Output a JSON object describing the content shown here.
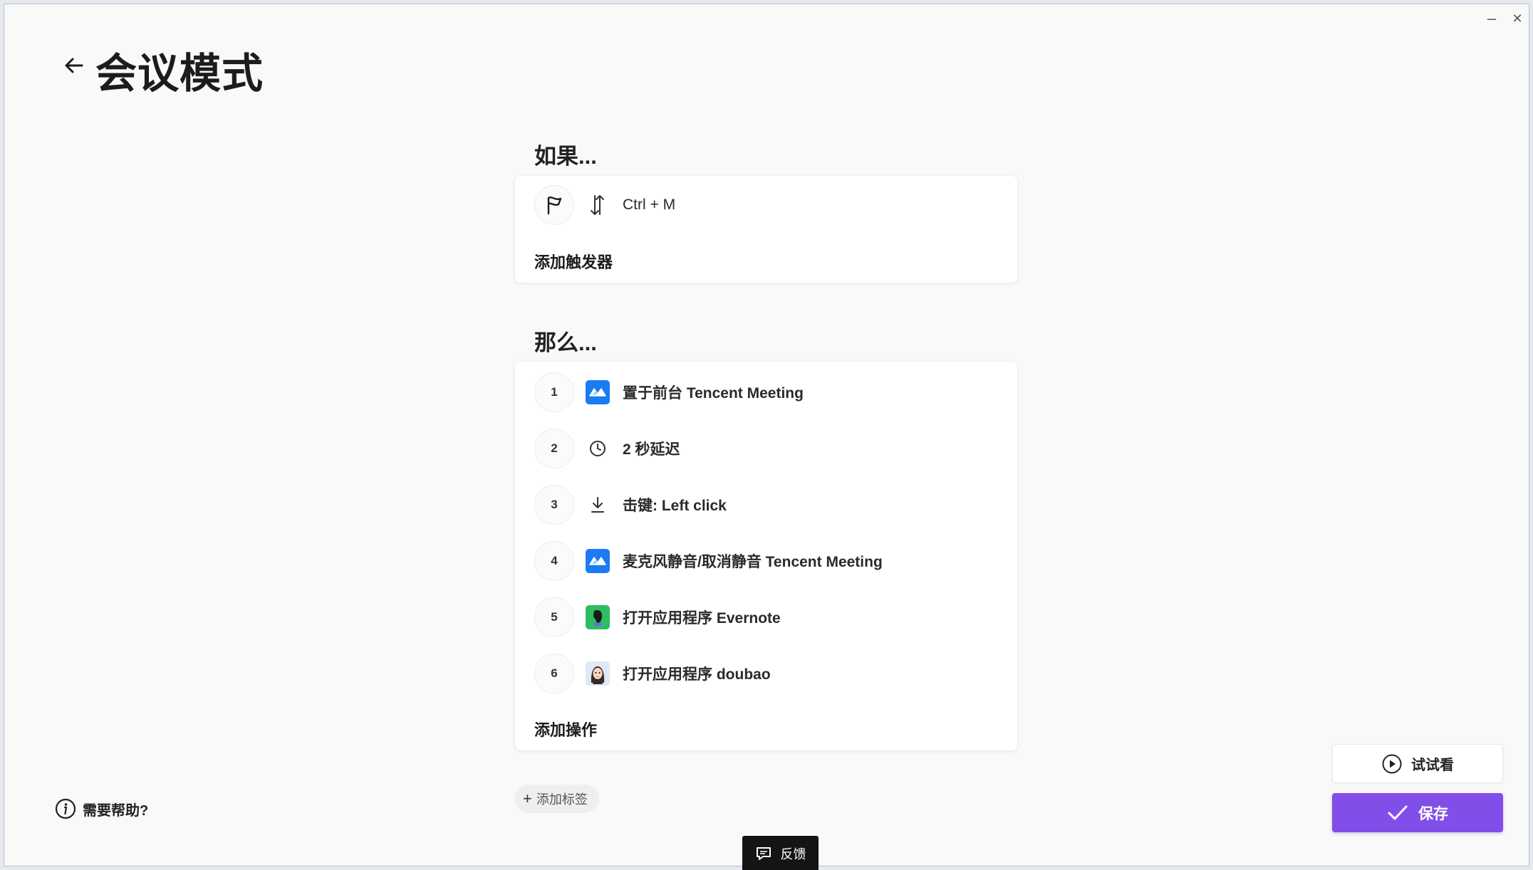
{
  "window": {
    "minimize": "–",
    "close": "✕"
  },
  "header": {
    "back_icon": "arrow-left-icon",
    "title": "会议模式"
  },
  "if_section": {
    "title": "如果...",
    "trigger": {
      "icon": "flag-icon",
      "type_icon": "up-down-arrows-icon",
      "label": "Ctrl + M"
    },
    "add_trigger": "添加触发器"
  },
  "then_section": {
    "title": "那么...",
    "actions": [
      {
        "num": "1",
        "icon": "tencent-meeting-icon",
        "label": "置于前台 Tencent Meeting"
      },
      {
        "num": "2",
        "icon": "clock-icon",
        "label": "2 秒延迟"
      },
      {
        "num": "3",
        "icon": "download-arrow-icon",
        "label": "击键: Left click"
      },
      {
        "num": "4",
        "icon": "tencent-meeting-icon",
        "label": "麦克风静音/取消静音 Tencent Meeting"
      },
      {
        "num": "5",
        "icon": "evernote-icon",
        "label": "打开应用程序 Evernote"
      },
      {
        "num": "6",
        "icon": "doubao-avatar-icon",
        "label": "打开应用程序 doubao"
      }
    ],
    "add_action": "添加操作"
  },
  "tags": {
    "add_tag": "添加标签"
  },
  "help": {
    "label": "需要帮助?"
  },
  "feedback": {
    "label": "反馈"
  },
  "buttons": {
    "try": "试试看",
    "save": "保存"
  },
  "colors": {
    "accent": "#814eea",
    "tencent_blue": "#1a7bf2",
    "evernote_green": "#2dbe60",
    "background": "#f9f9f9"
  }
}
